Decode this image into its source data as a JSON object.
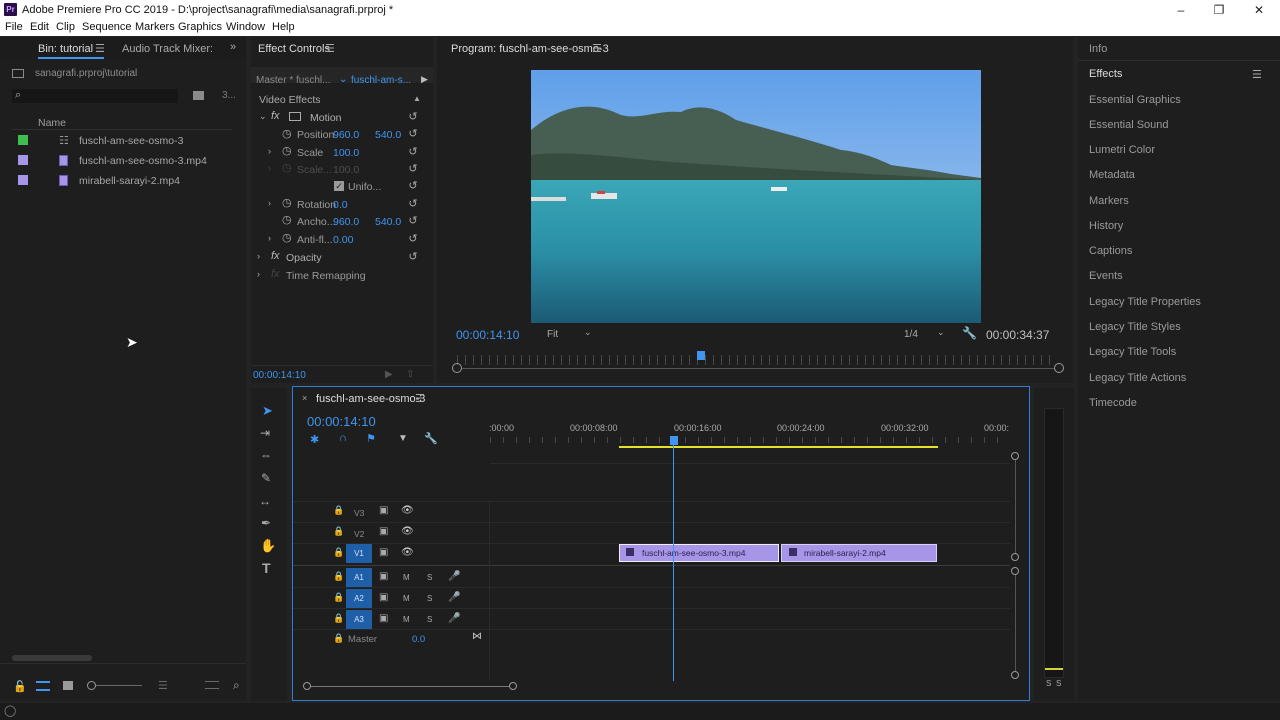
{
  "window": {
    "title": "Adobe Premiere Pro CC 2019 - D:\\project\\sanagrafi\\media\\sanagrafi.prproj *",
    "app_icon": "Pr"
  },
  "menu": [
    "File",
    "Edit",
    "Clip",
    "Sequence",
    "Markers",
    "Graphics",
    "Window",
    "Help"
  ],
  "project_panel": {
    "tabs": [
      "Bin: tutorial",
      "Audio Track Mixer: fu"
    ],
    "path": "sanagrafi.prproj\\tutorial",
    "count_label": "3...",
    "column_header": "Name",
    "items": [
      {
        "name": "fuschl-am-see-osmo-3",
        "label_color": "#3fbf4f",
        "icon": "sequence-icon"
      },
      {
        "name": "fuschl-am-see-osmo-3.mp4",
        "label_color": "#a795e8",
        "icon": "video-clip-icon"
      },
      {
        "name": "mirabell-sarayi-2.mp4",
        "label_color": "#a795e8",
        "icon": "video-clip-icon"
      }
    ]
  },
  "effect_controls": {
    "tab": "Effect Controls",
    "master": "Master * fuschl...",
    "clip": "fuschl-am-s...",
    "section": "Video Effects",
    "motion": {
      "label": "Motion",
      "position_label": "Position",
      "position_x": "960.0",
      "position_y": "540.0",
      "scale_label": "Scale",
      "scale_val": "100.0",
      "scale_w_label": "Scale...",
      "scale_w_val": "100.0",
      "uniform_label": "Unifo...",
      "rotation_label": "Rotation",
      "rotation_val": "0.0",
      "anchor_label": "Ancho...",
      "anchor_x": "960.0",
      "anchor_y": "540.0",
      "antiflicker_label": "Anti-fl...",
      "antiflicker_val": "0.00"
    },
    "opacity_label": "Opacity",
    "time_remap_label": "Time Remapping",
    "timecode": "00:00:14:10"
  },
  "program_monitor": {
    "tab": "Program: fuschl-am-see-osmo-3",
    "current_time": "00:00:14:10",
    "zoom": "Fit",
    "resolution": "1/4",
    "duration": "00:00:34:37",
    "playhead_fraction": 0.406
  },
  "timeline": {
    "tab": "fuschl-am-see-osmo-3",
    "timecode": "00:00:14:10",
    "ruler_labels": [
      ":00:00",
      "00:00:08:00",
      "00:00:16:00",
      "00:00:24:00",
      "00:00:32:00",
      "00:00:"
    ],
    "video_tracks": [
      "V3",
      "V2",
      "V1"
    ],
    "audio_tracks": [
      "A1",
      "A2",
      "A3"
    ],
    "master_label": "Master",
    "master_val": "0.0",
    "mute_label": "M",
    "solo_label": "S",
    "clips": [
      "fuschl-am-see-osmo-3.mp4",
      "mirabell-sarayi-2.mp4"
    ]
  },
  "right_panel": {
    "items": [
      "Info",
      "Effects",
      "Essential Graphics",
      "Essential Sound",
      "Lumetri Color",
      "Metadata",
      "Markers",
      "History",
      "Captions",
      "Events",
      "Legacy Title Properties",
      "Legacy Title Styles",
      "Legacy Title Tools",
      "Legacy Title Actions",
      "Timecode"
    ],
    "active_item": "Effects"
  },
  "audio_meter": {
    "solo_labels": [
      "S",
      "S"
    ]
  },
  "colors": {
    "accent": "#3f95f0",
    "clip_fill": "#a795e8",
    "work_area": "#e5e02a"
  }
}
